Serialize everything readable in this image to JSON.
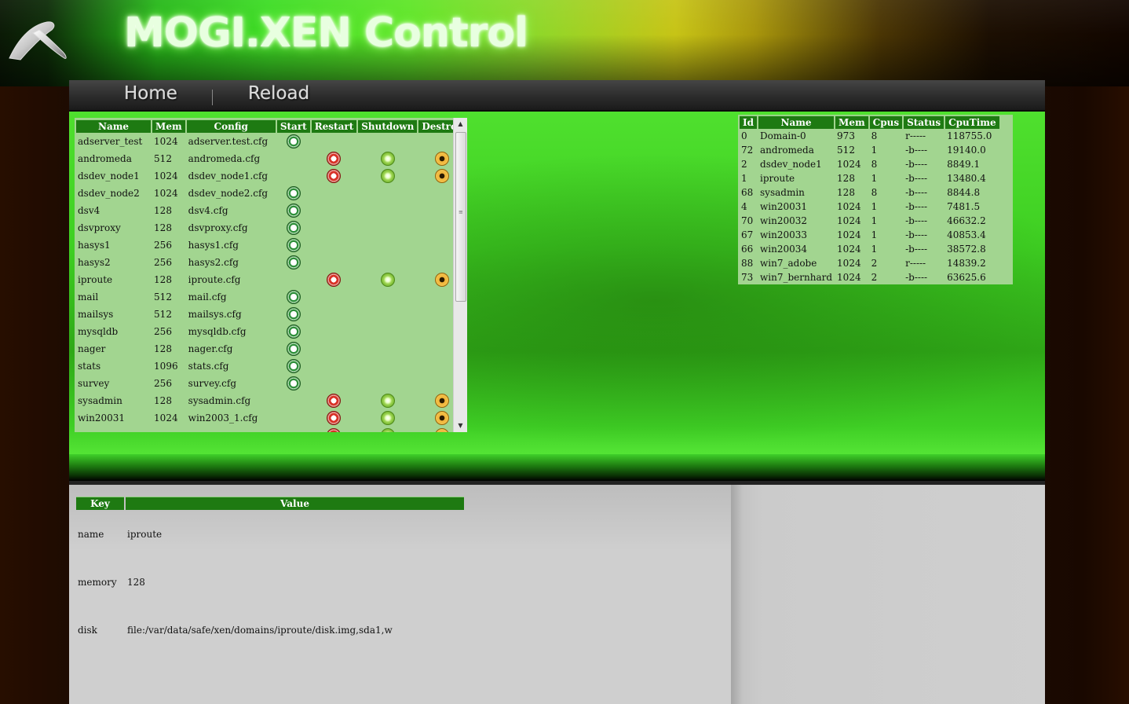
{
  "app": {
    "title": "MOGI.XEN Control",
    "nav": [
      "Home",
      "Reload"
    ]
  },
  "domains_table": {
    "headers": [
      "Name",
      "Mem",
      "Config",
      "Start",
      "Restart",
      "Shutdown",
      "Destroy"
    ],
    "rows": [
      {
        "name": "adserver_test",
        "mem": "1024",
        "config": "adserver.test.cfg",
        "running": false
      },
      {
        "name": "andromeda",
        "mem": "512",
        "config": "andromeda.cfg",
        "running": true
      },
      {
        "name": "dsdev_node1",
        "mem": "1024",
        "config": "dsdev_node1.cfg",
        "running": true
      },
      {
        "name": "dsdev_node2",
        "mem": "1024",
        "config": "dsdev_node2.cfg",
        "running": false
      },
      {
        "name": "dsv4",
        "mem": "128",
        "config": "dsv4.cfg",
        "running": false
      },
      {
        "name": "dsvproxy",
        "mem": "128",
        "config": "dsvproxy.cfg",
        "running": false
      },
      {
        "name": "hasys1",
        "mem": "256",
        "config": "hasys1.cfg",
        "running": false
      },
      {
        "name": "hasys2",
        "mem": "256",
        "config": "hasys2.cfg",
        "running": false
      },
      {
        "name": "iproute",
        "mem": "128",
        "config": "iproute.cfg",
        "running": true
      },
      {
        "name": "mail",
        "mem": "512",
        "config": "mail.cfg",
        "running": false
      },
      {
        "name": "mailsys",
        "mem": "512",
        "config": "mailsys.cfg",
        "running": false
      },
      {
        "name": "mysqldb",
        "mem": "256",
        "config": "mysqldb.cfg",
        "running": false
      },
      {
        "name": "nager",
        "mem": "128",
        "config": "nager.cfg",
        "running": false
      },
      {
        "name": "stats",
        "mem": "1096",
        "config": "stats.cfg",
        "running": false
      },
      {
        "name": "survey",
        "mem": "256",
        "config": "survey.cfg",
        "running": false
      },
      {
        "name": "sysadmin",
        "mem": "128",
        "config": "sysadmin.cfg",
        "running": true
      },
      {
        "name": "win20031",
        "mem": "1024",
        "config": "win2003_1.cfg",
        "running": true
      },
      {
        "name": "",
        "mem": "",
        "config": "",
        "running": true
      }
    ]
  },
  "status_table": {
    "headers": [
      "Id",
      "Name",
      "Mem",
      "Cpus",
      "Status",
      "CpuTime"
    ],
    "rows": [
      [
        "0",
        "Domain-0",
        "973",
        "8",
        "r-----",
        "118755.0"
      ],
      [
        "72",
        "andromeda",
        "512",
        "1",
        "-b----",
        "19140.0"
      ],
      [
        "2",
        "dsdev_node1",
        "1024",
        "8",
        "-b----",
        "8849.1"
      ],
      [
        "1",
        "iproute",
        "128",
        "1",
        "-b----",
        "13480.4"
      ],
      [
        "68",
        "sysadmin",
        "128",
        "8",
        "-b----",
        "8844.8"
      ],
      [
        "4",
        "win20031",
        "1024",
        "1",
        "-b----",
        "7481.5"
      ],
      [
        "70",
        "win20032",
        "1024",
        "1",
        "-b----",
        "46632.2"
      ],
      [
        "67",
        "win20033",
        "1024",
        "1",
        "-b----",
        "40853.4"
      ],
      [
        "66",
        "win20034",
        "1024",
        "1",
        "-b----",
        "38572.8"
      ],
      [
        "88",
        "win7_adobe",
        "1024",
        "2",
        "r-----",
        "14839.2"
      ],
      [
        "73",
        "win7_bernhard",
        "1024",
        "2",
        "-b----",
        "63625.6"
      ]
    ]
  },
  "details_table": {
    "headers": [
      "Key",
      "Value"
    ],
    "rows": [
      [
        "name",
        "iproute"
      ],
      [
        "memory",
        "128"
      ],
      [
        "disk",
        "file:/var/data/safe/xen/domains/iproute/disk.img,sda1,w"
      ]
    ]
  }
}
